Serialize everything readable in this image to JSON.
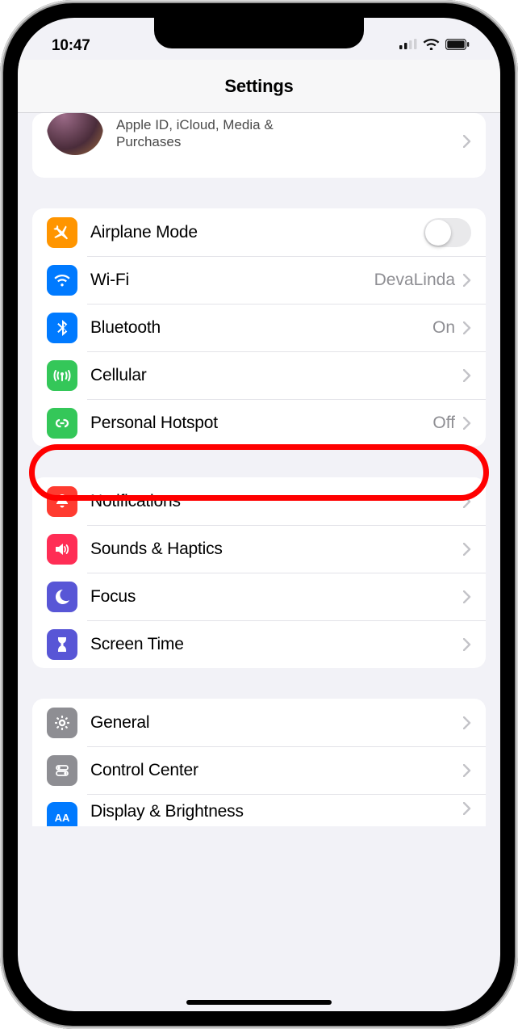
{
  "statusbar": {
    "time": "10:47"
  },
  "header": {
    "title": "Settings"
  },
  "profile": {
    "subtitle": "Apple ID, iCloud, Media & Purchases"
  },
  "rows": {
    "airplane": {
      "label": "Airplane Mode",
      "icon_bg": "#FF9500"
    },
    "wifi": {
      "label": "Wi-Fi",
      "value": "DevaLinda",
      "icon_bg": "#007AFF"
    },
    "bluetooth": {
      "label": "Bluetooth",
      "value": "On",
      "icon_bg": "#007AFF"
    },
    "cellular": {
      "label": "Cellular",
      "icon_bg": "#34C759"
    },
    "hotspot": {
      "label": "Personal Hotspot",
      "value": "Off",
      "icon_bg": "#34C759"
    },
    "notifications": {
      "label": "Notifications",
      "icon_bg": "#FF3B30"
    },
    "sounds": {
      "label": "Sounds & Haptics",
      "icon_bg": "#FF2D55"
    },
    "focus": {
      "label": "Focus",
      "icon_bg": "#5856D6"
    },
    "screentime": {
      "label": "Screen Time",
      "icon_bg": "#5856D6"
    },
    "general": {
      "label": "General",
      "icon_bg": "#8E8E93"
    },
    "control": {
      "label": "Control Center",
      "icon_bg": "#8E8E93"
    },
    "display": {
      "label": "Display & Brightness",
      "icon_bg": "#007AFF"
    }
  }
}
